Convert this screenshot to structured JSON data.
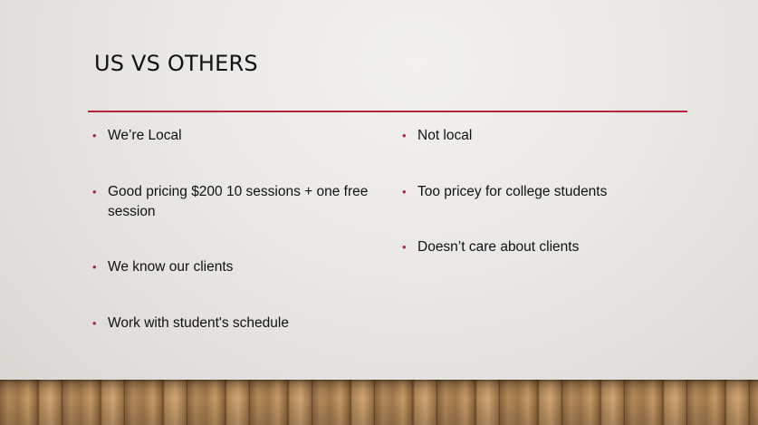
{
  "slide": {
    "title": "US VS OTHERS",
    "accent_color": "#b5243f",
    "left_column": [
      {
        "bullet": "•",
        "text": "We’re Local"
      },
      {
        "bullet": "•",
        "text": "Good pricing $200 10 sessions + one free session"
      },
      {
        "bullet": "•",
        "text": "We know our clients"
      },
      {
        "bullet": "•",
        "text": "Work with student's schedule"
      }
    ],
    "right_column": [
      {
        "bullet": "•",
        "text": "Not local"
      },
      {
        "bullet": "•",
        "text": "Too pricey for college students"
      },
      {
        "bullet": "•",
        "text": "Doesn’t care about clients"
      }
    ]
  }
}
